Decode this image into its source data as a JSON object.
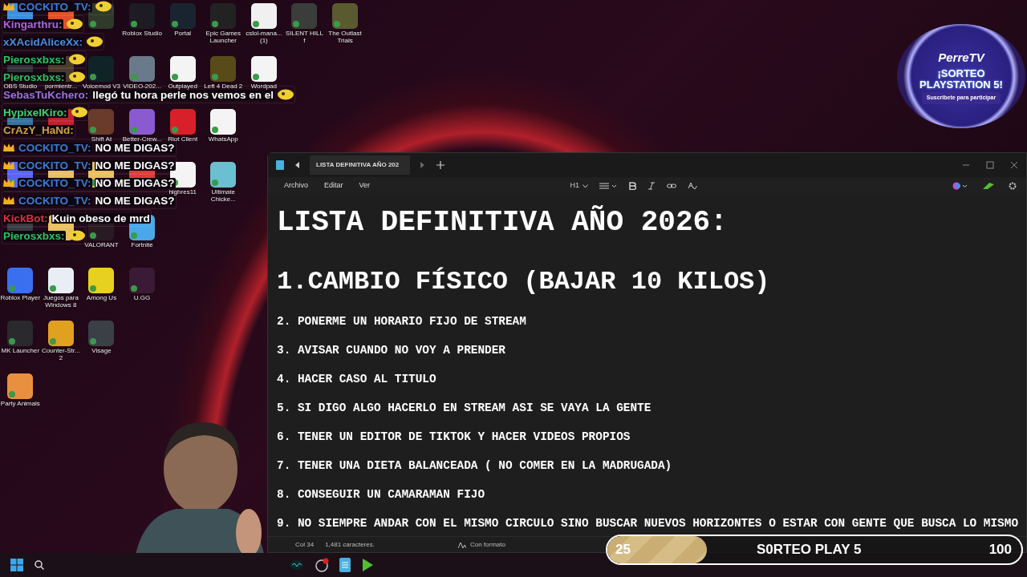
{
  "desktop": {
    "rows": [
      [
        {
          "color": "#3b8fe0"
        },
        {
          "color": "#e0502a"
        },
        {
          "color": "#2f3a2a"
        },
        {
          "label": "Roblox Studio",
          "color": "#1c1c22"
        },
        {
          "label": "Portal",
          "color": "#1a2430"
        },
        {
          "label": "Epic Games Launcher",
          "color": "#222222"
        },
        {
          "label": "cslol-mana... (1)",
          "color": "#f0f0f0"
        },
        {
          "label": "SILENT HILL f",
          "color": "#3a3e3a"
        },
        {
          "label": "The Outlast Trials",
          "color": "#5a5a30"
        }
      ],
      [
        {
          "label": "OBS Studio",
          "color": "#303036"
        },
        {
          "label": "pormientr...",
          "color": "#4a3a2a"
        },
        {
          "label": "Voicemod V3",
          "color": "#102428"
        },
        {
          "label": "VIDEO-202...",
          "color": "#6a7a8a"
        },
        {
          "label": "Outplayed",
          "color": "#f4f4f4"
        },
        {
          "label": "Left 4 Dead 2",
          "color": "#5a4a1a"
        },
        {
          "label": "Wordpad",
          "color": "#f4f4f4"
        }
      ],
      [
        {
          "color": "#3a6fa0"
        },
        {
          "color": "#c02030"
        },
        {
          "label": "Shift At",
          "color": "#6a3a2a"
        },
        {
          "label": "Better-Crew...",
          "color": "#8a5ad0"
        },
        {
          "label": "Riot Client",
          "color": "#d8202a"
        },
        {
          "label": "WhatsApp",
          "color": "#f4f4f4"
        }
      ],
      [
        {
          "color": "#5865f2"
        },
        {
          "color": "#e8c060"
        },
        {
          "color": "#e8c060"
        },
        {
          "color": "#e03a3a"
        },
        {
          "label": "highres11",
          "color": "#f4f4f4"
        },
        {
          "label": "Ultimate Chicke...",
          "color": "#6ac0d0"
        }
      ],
      [
        {
          "color": "#3a3a44"
        },
        {
          "color": "#e8c060"
        },
        {
          "label": "VALORANT",
          "color": "#2a1a22"
        },
        {
          "label": "Fortnite",
          "color": "#4aa8e8"
        }
      ],
      [
        {
          "label": "Roblox Player",
          "color": "#3a70f0"
        },
        {
          "label": "Juegos para Windows 8",
          "color": "#e8eef4"
        },
        {
          "label": "Among Us",
          "color": "#e8d020"
        },
        {
          "label": "U.GG",
          "color": "#3a1a34"
        }
      ],
      [
        {
          "label": "MK Launcher",
          "color": "#2a2a2e"
        },
        {
          "label": "Counter-Str... 2",
          "color": "#e0a020"
        },
        {
          "label": "Visage",
          "color": "#3a4046"
        }
      ],
      [
        {
          "label": "Party Animals",
          "color": "#e89040"
        }
      ]
    ]
  },
  "chat": [
    {
      "user": "COCKITO_TV:",
      "color": "#3a7bd5",
      "crown": true,
      "emote": true
    },
    {
      "user": "Kingarthru:",
      "color": "#b060e0",
      "crown": false,
      "emote": true
    },
    {
      "user": "xXAcidAliceXx:",
      "color": "#4a8be0",
      "crown": false,
      "emote": true
    },
    {
      "user": "Pierosxbxs:",
      "color": "#30c060",
      "crown": false,
      "emote": true
    },
    {
      "user": "Pierosxbxs:",
      "color": "#30c060",
      "crown": false,
      "emote": true
    },
    {
      "user": "SebasTuKchero:",
      "color": "#a070e0",
      "text": "llegó tu hora perle nos vemos en el",
      "crown": false,
      "emote": true
    },
    {
      "user": "HypixelKiro:",
      "color": "#40d070",
      "crown": false,
      "emote": true
    },
    {
      "user": "CrAzY_HaNd:",
      "color": "#d0a040",
      "crown": false,
      "emote": false
    },
    {
      "user": "COCKITO_TV:",
      "color": "#3a7bd5",
      "text": "NO ME DIGAS?",
      "crown": true,
      "emote": false
    },
    {
      "user": "COCKITO_TV:",
      "color": "#3a7bd5",
      "text": "NO ME DIGAS?",
      "crown": true,
      "emote": false
    },
    {
      "user": "COCKITO_TV:",
      "color": "#3a7bd5",
      "text": "NO ME DIGAS?",
      "crown": true,
      "emote": false
    },
    {
      "user": "COCKITO_TV:",
      "color": "#3a7bd5",
      "text": "NO ME DIGAS?",
      "crown": true,
      "emote": false
    },
    {
      "user": "KickBot:",
      "color": "#e03040",
      "text": "Kuin obeso de mrd",
      "crown": false,
      "emote": false
    },
    {
      "user": "Pierosxbxs:",
      "color": "#30c060",
      "crown": false,
      "emote": true
    }
  ],
  "giveaway_badge": {
    "brand": "PerreTV",
    "title": "¡SORTEO PLAYSTATION 5!",
    "subtitle": "Suscribete para participar"
  },
  "notepad": {
    "tab": "LISTA DEFINITIVA AÑO 202",
    "menu": [
      "Archivo",
      "Editar",
      "Ver"
    ],
    "heading_style": "H1",
    "lines": [
      {
        "kind": "title",
        "text": "LISTA DEFINITIVA AÑO 2026:"
      },
      {
        "kind": "heading",
        "text": "1.CAMBIO FÍSICO (BAJAR 10 KILOS)"
      },
      {
        "kind": "item",
        "text": "2. PONERME UN HORARIO FIJO DE STREAM"
      },
      {
        "kind": "item",
        "text": "3. AVISAR CUANDO NO VOY A PRENDER"
      },
      {
        "kind": "item",
        "text": "4. HACER CASO AL TITULO"
      },
      {
        "kind": "item",
        "text": "5. SI DIGO ALGO HACERLO EN STREAM ASI SE VAYA LA GENTE"
      },
      {
        "kind": "item",
        "text": "6. TENER UN EDITOR DE TIKTOK Y HACER VIDEOS PROPIOS"
      },
      {
        "kind": "item",
        "text": "7. TENER UNA DIETA BALANCEADA ( NO COMER EN LA MADRUGADA)"
      },
      {
        "kind": "item",
        "text": "8. CONSEGUIR UN CAMARAMAN FIJO"
      },
      {
        "kind": "item",
        "text": "9. NO SIEMPRE ANDAR CON EL MISMO CIRCULO SINO BUSCAR NUEVOS HORIZONTES O ESTAR CON GENTE QUE BUSCA LO MISMO"
      }
    ],
    "status": {
      "position": "Col 34",
      "characters": "1,481 caracteres.",
      "format": "Con formato"
    }
  },
  "goal_bar": {
    "current": "25",
    "title": "S0RTEO PLAY 5",
    "target": "100",
    "level": 0.24
  }
}
